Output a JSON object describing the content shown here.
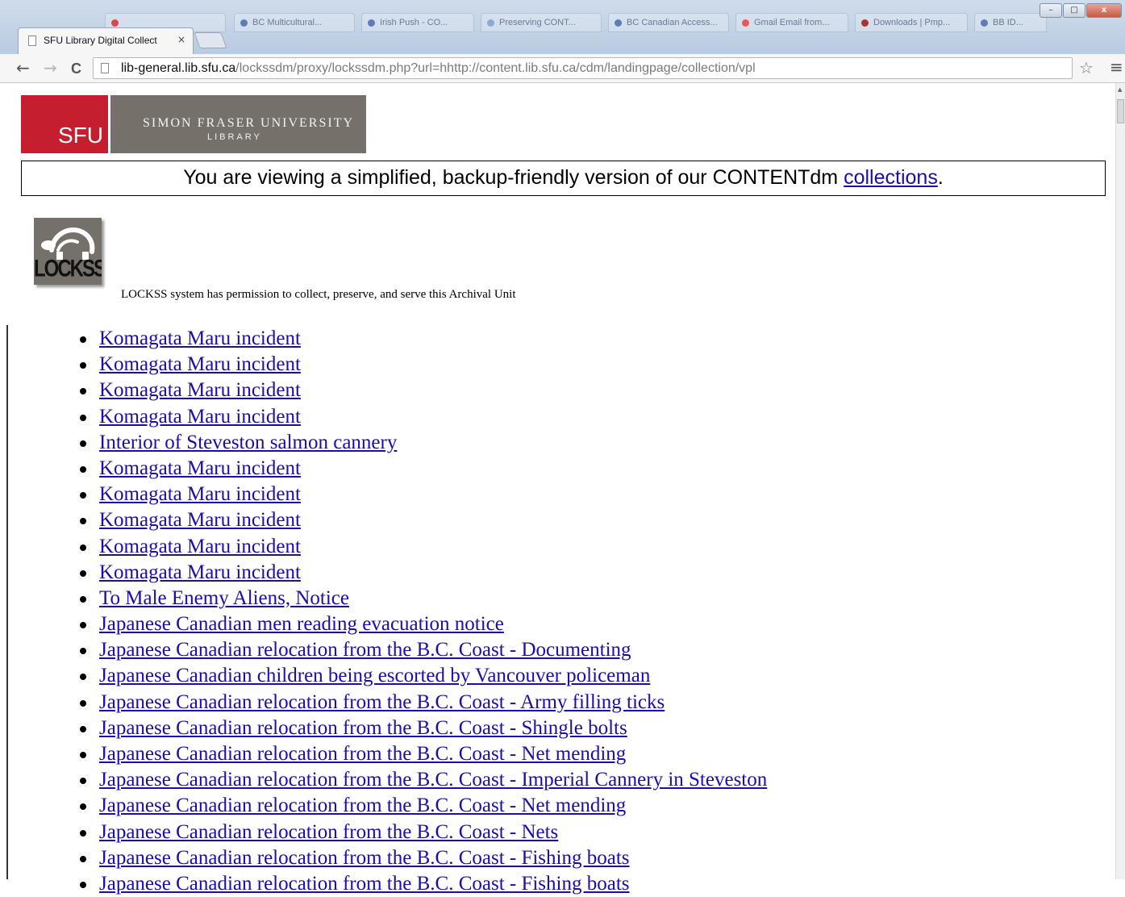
{
  "browser": {
    "background_tabs": [
      "",
      "BC Multicultural...",
      "Irish Push - CO...",
      "Preserving CONT...",
      "BC Canadian Access...",
      "Gmail Email from...",
      "Downloads | Pmp...",
      "BB ID..."
    ],
    "active_tab": {
      "title": "SFU Library Digital Collect",
      "close": "×"
    },
    "window_buttons": {
      "minimize": "–",
      "maximize": "□",
      "close": "x"
    },
    "nav": {
      "back": "←",
      "forward": "→",
      "reload": "C",
      "menu": "≡",
      "star": "☆"
    },
    "url_host": "lib-general.lib.sfu.ca",
    "url_path": "/lockssdm/proxy/lockssdm.php?url=hhttp://content.lib.sfu.ca/cdm/landingpage/collection/vpl"
  },
  "banner": {
    "abbr": "SFU",
    "university": "SIMON FRASER UNIVERSITY",
    "library": "LIBRARY"
  },
  "notice": {
    "text": "You are viewing a simplified, backup-friendly version of our CONTENTdm ",
    "link": "collections",
    "end": "."
  },
  "lockss": {
    "logo_text": "LOCKSS",
    "caption": "LOCKSS system has permission to collect, preserve, and serve this Archival Unit"
  },
  "items": [
    "Komagata Maru incident",
    "Komagata Maru incident",
    "Komagata Maru incident",
    "Komagata Maru incident",
    "Interior of Steveston salmon cannery",
    "Komagata Maru incident",
    "Komagata Maru incident",
    "Komagata Maru incident",
    "Komagata Maru incident",
    "Komagata Maru incident",
    "To Male Enemy Aliens, Notice",
    "Japanese Canadian men reading evacuation notice",
    "Japanese Canadian relocation from the B.C. Coast - Documenting",
    "Japanese Canadian children being escorted by Vancouver policeman",
    "Japanese Canadian relocation from the B.C. Coast - Army filling ticks",
    "Japanese Canadian relocation from the B.C. Coast - Shingle bolts",
    "Japanese Canadian relocation from the B.C. Coast - Net mending",
    "Japanese Canadian relocation from the B.C. Coast - Imperial Cannery in Steveston",
    "Japanese Canadian relocation from the B.C. Coast - Net mending",
    "Japanese Canadian relocation from the B.C. Coast - Nets",
    "Japanese Canadian relocation from the B.C. Coast - Fishing boats",
    "Japanese Canadian relocation from the B.C. Coast - Fishing boats"
  ],
  "colors": {
    "sfu_red": "#c41e2f",
    "sfu_gray": "#75716a",
    "link": "#1a0dab"
  }
}
